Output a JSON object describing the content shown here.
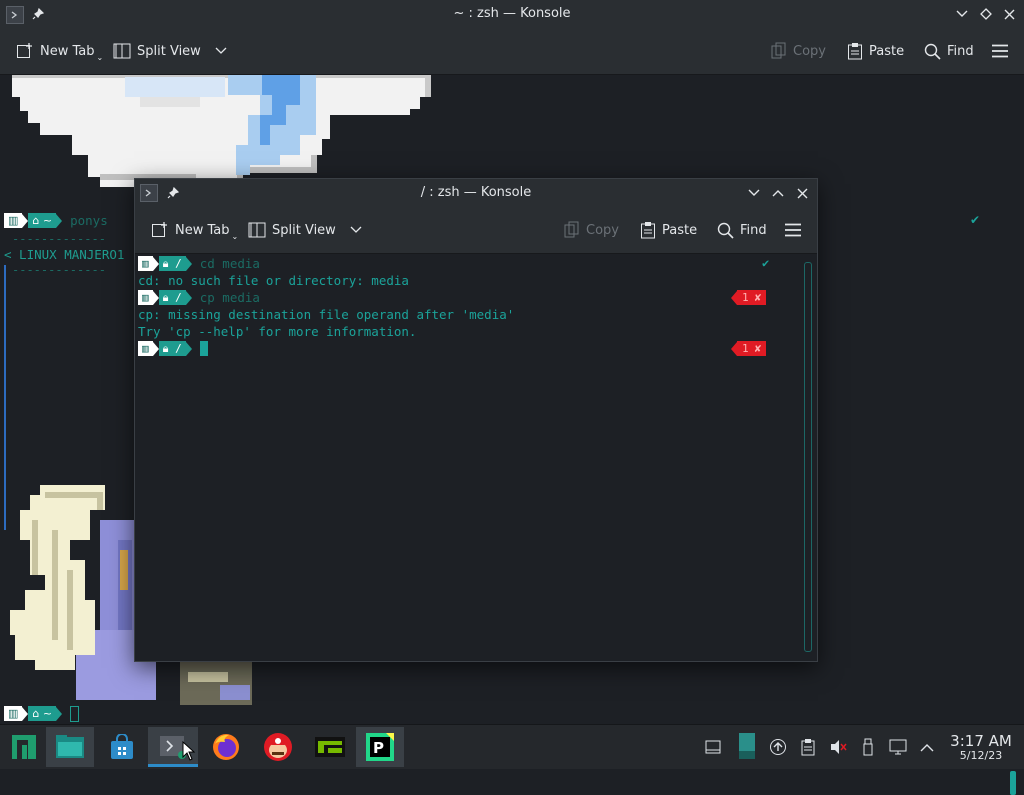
{
  "bg_window": {
    "title": "~ : zsh — Konsole",
    "toolbar": {
      "new_tab": "New Tab",
      "split_view": "Split View",
      "copy": "Copy",
      "paste": "Paste",
      "find": "Find"
    },
    "banner_text": "< LINUX MANJERO1",
    "banner_dashes": "-------------",
    "prompt_user_text": "ponys",
    "prompt_home": "~"
  },
  "fg_window": {
    "title": "/ : zsh — Konsole",
    "toolbar": {
      "new_tab": "New Tab",
      "split_view": "Split View",
      "copy": "Copy",
      "paste": "Paste",
      "find": "Find"
    },
    "prompt_dir": "/",
    "lines": {
      "cmd1": "cd media",
      "out1": "cd: no such file or directory: media",
      "cmd2": "cp media",
      "out2": "cp: missing destination file operand after 'media'",
      "out3": "Try 'cp --help' for more information."
    },
    "error_code": "1",
    "error_mark": "✘",
    "success_mark": "✔"
  },
  "taskbar": {
    "time": "3:17 AM",
    "date": "5/12/23"
  },
  "colors": {
    "accent_teal": "#1e9c8f",
    "error_red": "#e01b24",
    "taskbar_active": "#2d8cc9"
  }
}
